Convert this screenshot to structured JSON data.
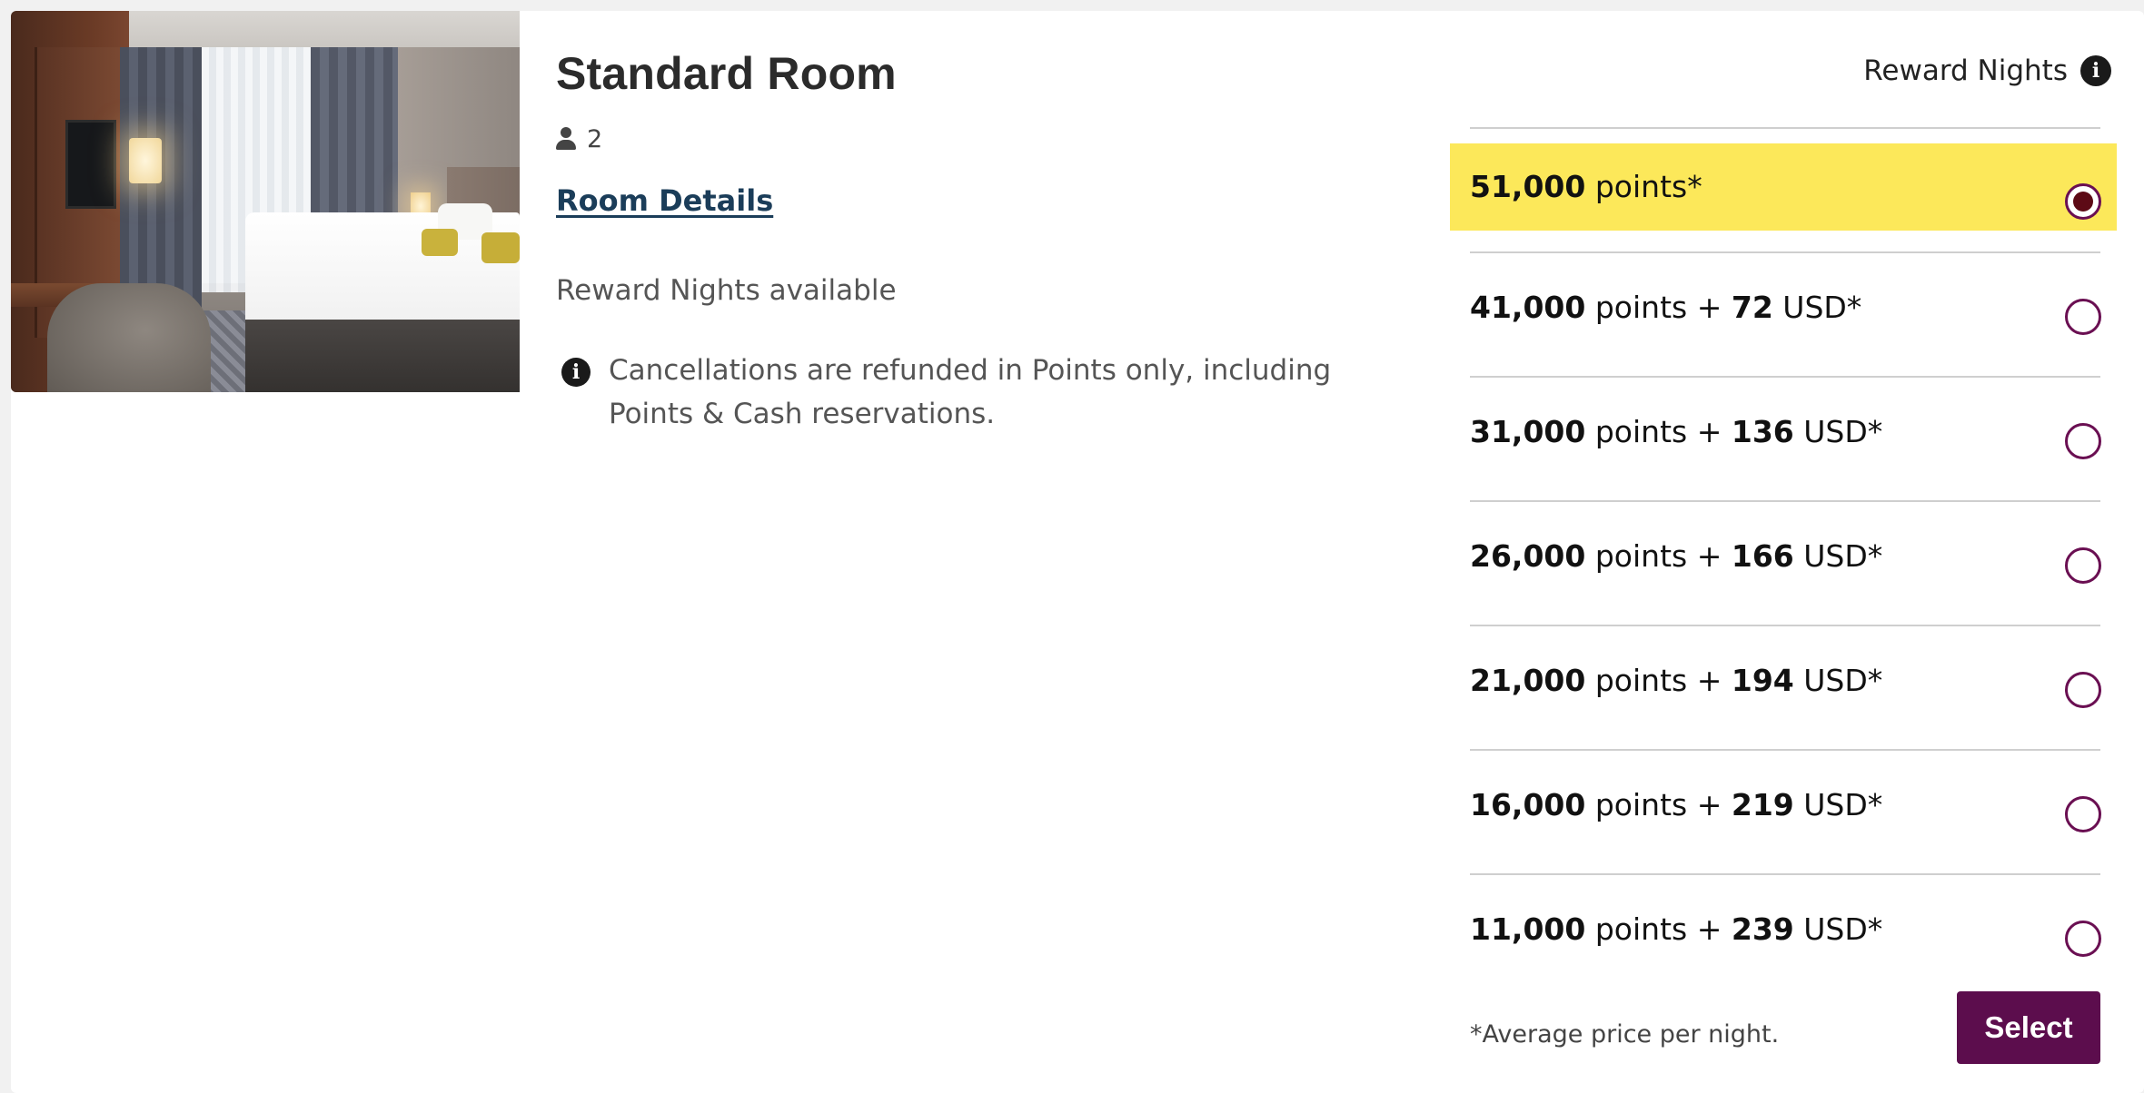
{
  "room": {
    "title": "Standard Room",
    "occupancy": "2",
    "details_link": "Room Details",
    "availability": "Reward Nights available",
    "cancellation_note": "Cancellations are refunded in Points only, including Points & Cash reservations."
  },
  "rates": {
    "header": "Reward Nights",
    "options": [
      {
        "points": "51,000",
        "points_label": "points*",
        "plus": "",
        "cash": "",
        "cash_label": "",
        "selected": true
      },
      {
        "points": "41,000",
        "points_label": "points",
        "plus": "+",
        "cash": "72",
        "cash_label": "USD*",
        "selected": false
      },
      {
        "points": "31,000",
        "points_label": "points",
        "plus": "+",
        "cash": "136",
        "cash_label": "USD*",
        "selected": false
      },
      {
        "points": "26,000",
        "points_label": "points",
        "plus": "+",
        "cash": "166",
        "cash_label": "USD*",
        "selected": false
      },
      {
        "points": "21,000",
        "points_label": "points",
        "plus": "+",
        "cash": "194",
        "cash_label": "USD*",
        "selected": false
      },
      {
        "points": "16,000",
        "points_label": "points",
        "plus": "+",
        "cash": "219",
        "cash_label": "USD*",
        "selected": false
      },
      {
        "points": "11,000",
        "points_label": "points",
        "plus": "+",
        "cash": "239",
        "cash_label": "USD*",
        "selected": false
      }
    ],
    "footnote": "*Average price per night.",
    "select_label": "Select"
  },
  "icons": {
    "info": "info-icon",
    "person": "person-icon"
  },
  "colors": {
    "selected_highlight": "#fce85a",
    "accent": "#5c0d4d",
    "link": "#1b3d59"
  }
}
